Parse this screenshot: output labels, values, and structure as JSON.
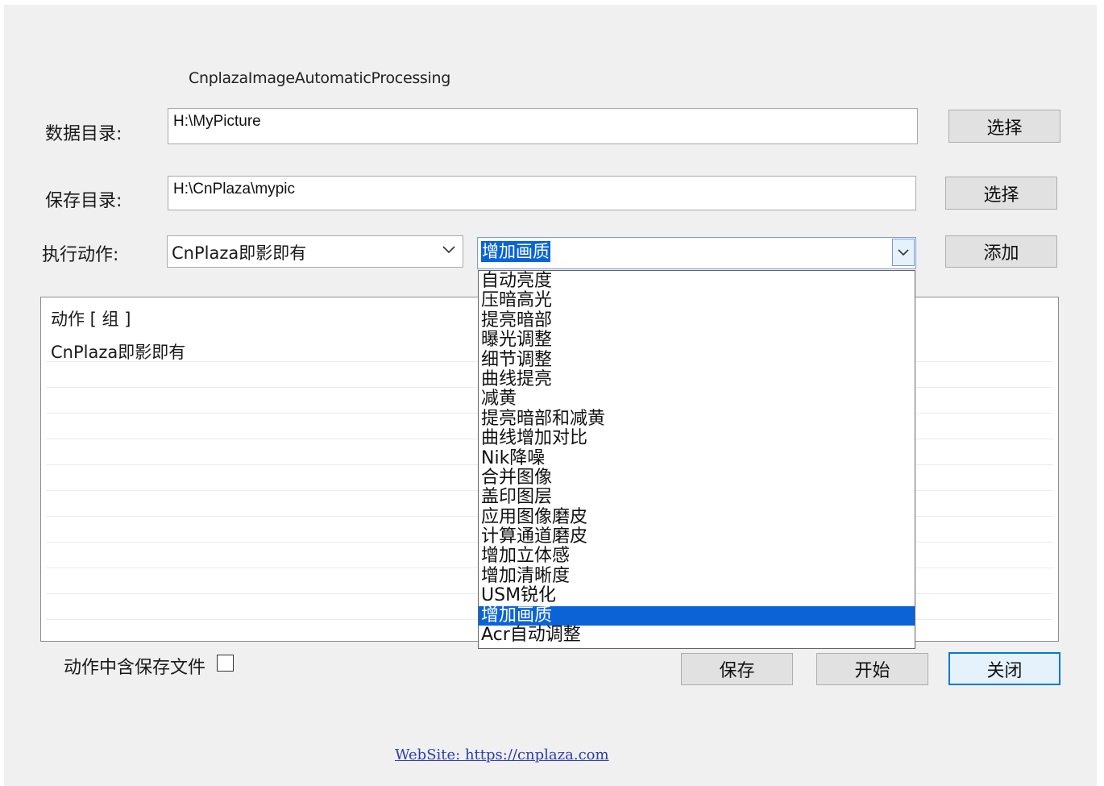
{
  "app_title": "CnplazaImageAutomaticProcessing",
  "data_dir": {
    "label": "数据目录:",
    "value": "H:\\MyPicture",
    "button": "选择"
  },
  "save_dir": {
    "label": "保存目录:",
    "value": "H:\\CnPlaza\\mypic",
    "button": "选择"
  },
  "action": {
    "label": "执行动作:",
    "group_combo_value": "CnPlaza即影即有",
    "action_combo_value": "增加画质",
    "add_button": "添加",
    "options": [
      "自动亮度",
      "压暗高光",
      "提亮暗部",
      "曝光调整",
      "细节调整",
      "曲线提亮",
      "减黄",
      "提亮暗部和减黄",
      "曲线增加对比",
      "Nik降噪",
      "合并图像",
      "盖印图层",
      "应用图像磨皮",
      "计算通道磨皮",
      "增加立体感",
      "增加清晰度",
      "USM锐化",
      "增加画质",
      "Acr自动调整"
    ],
    "selected_index": 17
  },
  "action_list": {
    "header": "动作 [ 组 ]",
    "rows": [
      "CnPlaza即影即有"
    ]
  },
  "include_save_file": {
    "label": "动作中含保存文件",
    "checked": false
  },
  "buttons": {
    "save": "保存",
    "start": "开始",
    "close": "关闭"
  },
  "website": "WebSite:  https://cnplaza.com",
  "colors": {
    "window_bg": "#f0f0f0",
    "selection": "#0a64d8",
    "focus_border": "#0078d7",
    "link": "#2f3bb5"
  }
}
